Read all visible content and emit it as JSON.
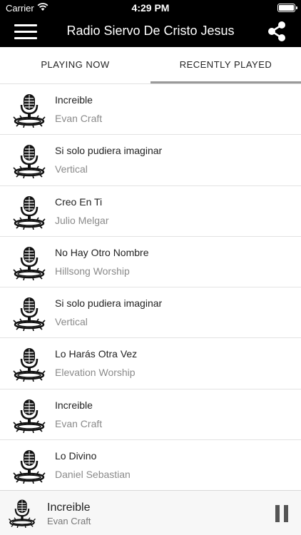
{
  "status_bar": {
    "carrier": "Carrier",
    "time": "4:29 PM"
  },
  "header": {
    "title": "Radio Siervo De Cristo Jesus",
    "menu_icon": "hamburger-menu-icon",
    "share_icon": "share-icon"
  },
  "tabs": [
    {
      "label": "PLAYING NOW",
      "active": false
    },
    {
      "label": "RECENTLY PLAYED",
      "active": true
    }
  ],
  "recently_played": [
    {
      "song": "Increible",
      "artist": "Evan Craft"
    },
    {
      "song": "Si solo pudiera imaginar",
      "artist": "Vertical"
    },
    {
      "song": "Creo En Ti",
      "artist": "Julio Melgar"
    },
    {
      "song": "No Hay Otro Nombre",
      "artist": "Hillsong Worship"
    },
    {
      "song": "Si solo pudiera imaginar",
      "artist": "Vertical"
    },
    {
      "song": "Lo Harás Otra Vez",
      "artist": "Elevation Worship"
    },
    {
      "song": "Increible",
      "artist": "Evan Craft"
    },
    {
      "song": "Lo Divino",
      "artist": "Daniel Sebastian"
    }
  ],
  "now_playing": {
    "song": "Increible",
    "artist": "Evan Craft",
    "control_icon": "pause-icon"
  },
  "thumbnail_icon": "microphone-crown-of-thorns-icon"
}
